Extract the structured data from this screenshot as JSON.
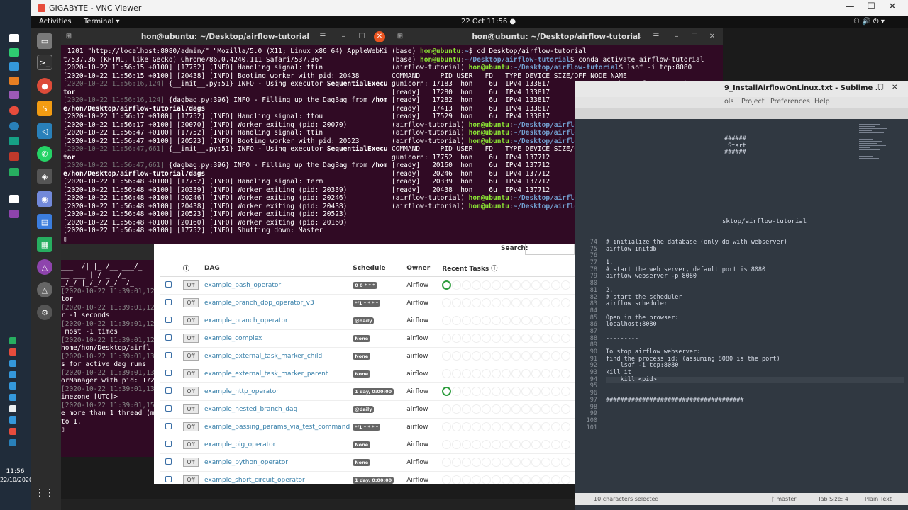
{
  "vnc": {
    "title": "GIGABYTE - VNC Viewer",
    "btn_min": "—",
    "btn_max": "☐",
    "btn_close": "✕"
  },
  "windows_taskbar": {
    "time": "11:56",
    "date": "22/10/2020"
  },
  "gnome": {
    "activities": "Activities",
    "app_menu": "Terminal ▾",
    "clock": "22 Oct  11:56  ●",
    "tray": "⚇ 🔊 ⏻ ▾"
  },
  "term_left": {
    "title": "hon@ubuntu: ~/Desktop/airflow-tutorial",
    "lines": [
      {
        "segs": [
          {
            "t": " 1201 \"http://localhost:8080/admin/\" \"Mozilla/5.0 (X11; Linux x86_64) AppleWebKi"
          }
        ]
      },
      {
        "segs": [
          {
            "t": "t/537.36 (KHTML, like Gecko) Chrome/86.0.4240.111 Safari/537.36\""
          }
        ]
      },
      {
        "segs": [
          {
            "t": "[2020-10-22 11:56:15 +0100] [17752] [INFO] Handling signal: ttin"
          }
        ]
      },
      {
        "segs": [
          {
            "t": "[2020-10-22 11:56:15 +0100] [20438] [INFO] Booting worker with pid: 20438"
          }
        ]
      },
      {
        "segs": [
          {
            "t": "[2020-10-22 11:56:16,124]",
            "c": "dim"
          },
          {
            "t": " {__init__.py:51} INFO - Using executor "
          },
          {
            "t": "SequentialExecu",
            "c": "bo"
          }
        ]
      },
      {
        "segs": [
          {
            "t": "tor",
            "c": "bo"
          }
        ]
      },
      {
        "segs": [
          {
            "t": "[2020-10-22 11:56:16,124]",
            "c": "dim"
          },
          {
            "t": " {dagbag.py:396} INFO - Filling up the DagBag from "
          },
          {
            "t": "/hom",
            "c": "bo"
          }
        ]
      },
      {
        "segs": [
          {
            "t": "e/hon/Desktop/airflow-tutorial/dags",
            "c": "bo"
          }
        ]
      },
      {
        "segs": [
          {
            "t": "[2020-10-22 11:56:17 +0100] [17752] [INFO] Handling signal: ttou"
          }
        ]
      },
      {
        "segs": [
          {
            "t": "[2020-10-22 11:56:17 +0100] [20070] [INFO] Worker exiting (pid: 20070)"
          }
        ]
      },
      {
        "segs": [
          {
            "t": "[2020-10-22 11:56:47 +0100] [17752] [INFO] Handling signal: ttin"
          }
        ]
      },
      {
        "segs": [
          {
            "t": "[2020-10-22 11:56:47 +0100] [20523] [INFO] Booting worker with pid: 20523"
          }
        ]
      },
      {
        "segs": [
          {
            "t": "[2020-10-22 11:56:47,661]",
            "c": "dim"
          },
          {
            "t": " {__init__.py:51} INFO - Using executor "
          },
          {
            "t": "SequentialExecu",
            "c": "bo"
          }
        ]
      },
      {
        "segs": [
          {
            "t": "tor",
            "c": "bo"
          }
        ]
      },
      {
        "segs": [
          {
            "t": "[2020-10-22 11:56:47,661]",
            "c": "dim"
          },
          {
            "t": " {dagbag.py:396} INFO - Filling up the DagBag from "
          },
          {
            "t": "/hom",
            "c": "bo"
          }
        ]
      },
      {
        "segs": [
          {
            "t": "e/hon/Desktop/airflow-tutorial/dags",
            "c": "bo"
          }
        ]
      },
      {
        "segs": [
          {
            "t": "[2020-10-22 11:56:48 +0100] [17752] [INFO] Handling signal: term"
          }
        ]
      },
      {
        "segs": [
          {
            "t": "[2020-10-22 11:56:48 +0100] [20339] [INFO] Worker exiting (pid: 20339)"
          }
        ]
      },
      {
        "segs": [
          {
            "t": "[2020-10-22 11:56:48 +0100] [20246] [INFO] Worker exiting (pid: 20246)"
          }
        ]
      },
      {
        "segs": [
          {
            "t": "[2020-10-22 11:56:48 +0100] [20438] [INFO] Worker exiting (pid: 20438)"
          }
        ]
      },
      {
        "segs": [
          {
            "t": "[2020-10-22 11:56:48 +0100] [20523] [INFO] Worker exiting (pid: 20523)"
          }
        ]
      },
      {
        "segs": [
          {
            "t": "[2020-10-22 11:56:48 +0100] [20160] [INFO] Worker exiting (pid: 20160)"
          }
        ]
      },
      {
        "segs": [
          {
            "t": "[2020-10-22 11:56:48 +0100] [17752] [INFO] Shutting down: Master"
          }
        ]
      },
      {
        "segs": [
          {
            "t": "▯"
          }
        ]
      }
    ]
  },
  "term_right": {
    "title": "hon@ubuntu: ~/Desktop/airflow-tutorial",
    "lines": [
      {
        "segs": [
          {
            "t": "(base) "
          },
          {
            "t": "hon@ubuntu",
            "c": "pg"
          },
          {
            "t": ":"
          },
          {
            "t": "~",
            "c": "pb"
          },
          {
            "t": "$ cd Desktop/airflow-tutorial"
          }
        ]
      },
      {
        "segs": [
          {
            "t": "(base) "
          },
          {
            "t": "hon@ubuntu",
            "c": "pg"
          },
          {
            "t": ":"
          },
          {
            "t": "~/Desktop/airflow-tutorial",
            "c": "pb"
          },
          {
            "t": "$ conda activate airflow-tutorial"
          }
        ]
      },
      {
        "segs": [
          {
            "t": "(airflow-tutorial) "
          },
          {
            "t": "hon@ubuntu",
            "c": "pg"
          },
          {
            "t": ":"
          },
          {
            "t": "~/Desktop/airflow-tutorial",
            "c": "pb"
          },
          {
            "t": "$ lsof -i tcp:8080"
          }
        ]
      },
      {
        "segs": [
          {
            "t": "COMMAND     PID USER   FD   TYPE DEVICE SIZE/OFF NODE NAME"
          }
        ]
      },
      {
        "segs": [
          {
            "t": "gunicorn: 17183  hon    6u  IPv4 133817      0t0  TCP *:http-alt (LISTEN)"
          }
        ]
      },
      {
        "segs": [
          {
            "t": "[ready]   17280  hon    6u  IPv4 133817      0t0  TCP *:http-alt (LISTEN)"
          }
        ]
      },
      {
        "segs": [
          {
            "t": "[ready]   17282  hon    6u  IPv4 133817      0t0  TCP *:http-alt (LISTEN)"
          }
        ]
      },
      {
        "segs": [
          {
            "t": "[ready]   17413  hon    6u  IPv4 133817      0t0  TCP *:http-alt (LISTEN)"
          }
        ]
      },
      {
        "segs": [
          {
            "t": "[ready]   17529  hon    6u  IPv4 133817      0t0  TCP *:http-alt (LISTEN)"
          }
        ]
      },
      {
        "segs": [
          {
            "t": "(airflow-tutorial) "
          },
          {
            "t": "hon@ubuntu",
            "c": "pg"
          },
          {
            "t": ":"
          },
          {
            "t": "~/Desktop/airflow-tutorial",
            "c": "pb"
          },
          {
            "t": "$ kill 17183"
          }
        ]
      },
      {
        "segs": [
          {
            "t": "(airflow-tutorial) "
          },
          {
            "t": "hon@ubuntu",
            "c": "pg"
          },
          {
            "t": ":"
          },
          {
            "t": "~/Desktop/airflow-tutorial",
            "c": "pb"
          },
          {
            "t": "$ lsof -i tcp:8080"
          }
        ]
      },
      {
        "segs": [
          {
            "t": "(airflow-tutorial) "
          },
          {
            "t": "hon@ubuntu",
            "c": "pg"
          },
          {
            "t": ":"
          },
          {
            "t": "~/Desktop/airflow-tutorial",
            "c": "pb"
          },
          {
            "t": "$ lsof -i tcp:8080"
          }
        ]
      },
      {
        "segs": [
          {
            "t": "COMMAND     PID USER   FD   TYPE DEVICE SIZE/OFF NODE NAME"
          }
        ]
      },
      {
        "segs": [
          {
            "t": "gunicorn: 17752  hon    6u  IPv4 137712      0t0  TCP *:http-alt (LISTEN)"
          }
        ]
      },
      {
        "segs": [
          {
            "t": "[ready]   20160  hon    6u  IPv4 137712      0t0  TCP *:http-alt (LISTEN)"
          }
        ]
      },
      {
        "segs": [
          {
            "t": "[ready]   20246  hon    6u  IPv4 137712      0t0  TCP *:http-alt (LISTEN)"
          }
        ]
      },
      {
        "segs": [
          {
            "t": "[ready]   20339  hon    6u  IPv4 137712      0t0  TCP *:http-alt (LISTEN)"
          }
        ]
      },
      {
        "segs": [
          {
            "t": "[ready]   20438  hon    6u  IPv4 137712      0t0  TCP *:http-alt (LISTEN)"
          }
        ]
      },
      {
        "segs": [
          {
            "t": "(airflow-tutorial) "
          },
          {
            "t": "hon@ubuntu",
            "c": "pg"
          },
          {
            "t": ":"
          },
          {
            "t": "~/Desktop/airflow-tutorial",
            "c": "pb"
          },
          {
            "t": "$ kill 17752"
          }
        ]
      },
      {
        "segs": [
          {
            "t": "(airflow-tutorial) "
          },
          {
            "t": "hon@ubuntu",
            "c": "pg"
          },
          {
            "t": ":"
          },
          {
            "t": "~/Desktop/airflow-tutorial",
            "c": "pb"
          },
          {
            "t": "$ ▯"
          }
        ]
      }
    ]
  },
  "bg_term": {
    "lines": [
      {
        "t": "___  /| |_ /__ ___/_"
      },
      {
        "t": "__ ___ | / _  /_"
      },
      {
        "t": "_/_/ |_/_/ /_/  /_"
      },
      {
        "t": "[2020-10-22 11:39:01,12",
        "g": true
      },
      {
        "t": "tor"
      },
      {
        "t": "[2020-10-22 11:39:01,12",
        "g": true
      },
      {
        "t": "r -1 seconds"
      },
      {
        "t": "[2020-10-22 11:39:01,12",
        "g": true
      },
      {
        "t": " most -1 times"
      },
      {
        "t": "[2020-10-22 11:39:01,12",
        "g": true
      },
      {
        "t": "home/hon/Desktop/airfl"
      },
      {
        "t": "[2020-10-22 11:39:01,13",
        "g": true
      },
      {
        "t": "s for active dag runs"
      },
      {
        "t": "[2020-10-22 11:39:01,13",
        "g": true
      },
      {
        "t": "orManager with pid: 172"
      },
      {
        "t": "[2020-10-22 11:39:01,13",
        "g": true
      },
      {
        "t": "imezone [UTC]>"
      },
      {
        "t": "[2020-10-22 11:39:01,15",
        "g": true
      },
      {
        "t": "e more than 1 thread (m"
      },
      {
        "t": "to 1."
      },
      {
        "t": "▯"
      }
    ]
  },
  "airflow": {
    "search_label": "Search:",
    "headers": {
      "info": "ⓘ",
      "dag": "DAG",
      "schedule": "Schedule",
      "owner": "Owner",
      "recent": "Recent Tasks ⓘ"
    },
    "toggle_label": "Off",
    "rows": [
      {
        "dag": "example_bash_operator",
        "schedule": "0 0 * * *",
        "owner": "Airflow",
        "ok": true
      },
      {
        "dag": "example_branch_dop_operator_v3",
        "schedule": "*/1 * * * *",
        "owner": "Airflow",
        "ok": false
      },
      {
        "dag": "example_branch_operator",
        "schedule": "@daily",
        "owner": "Airflow",
        "ok": false
      },
      {
        "dag": "example_complex",
        "schedule": "None",
        "owner": "airflow",
        "ok": false
      },
      {
        "dag": "example_external_task_marker_child",
        "schedule": "None",
        "owner": "airflow",
        "ok": false
      },
      {
        "dag": "example_external_task_marker_parent",
        "schedule": "None",
        "owner": "airflow",
        "ok": false
      },
      {
        "dag": "example_http_operator",
        "schedule": "1 day, 0:00:00",
        "owner": "Airflow",
        "ok": true
      },
      {
        "dag": "example_nested_branch_dag",
        "schedule": "@daily",
        "owner": "airflow",
        "ok": false
      },
      {
        "dag": "example_passing_params_via_test_command",
        "schedule": "*/1 * * * *",
        "owner": "airflow",
        "ok": false
      },
      {
        "dag": "example_pig_operator",
        "schedule": "None",
        "owner": "Airflow",
        "ok": false
      },
      {
        "dag": "example_python_operator",
        "schedule": "None",
        "owner": "Airflow",
        "ok": false
      },
      {
        "dag": "example_short_circuit_operator",
        "schedule": "1 day, 0:00:00",
        "owner": "Airflow",
        "ok": false
      }
    ]
  },
  "sublime": {
    "title": "9_InstallAirflowOnLinux.txt - Sublime ...",
    "menu": [
      "ols",
      "Project",
      "Preferences",
      "Help"
    ],
    "top_text": "######\n Start\n######",
    "path_text": "sktop/airflow-tutorial",
    "lines": [
      {
        "n": "74",
        "c": "# initialize the database (only do with webserver)"
      },
      {
        "n": "75",
        "c": "airflow initdb"
      },
      {
        "n": "76",
        "c": ""
      },
      {
        "n": "77",
        "c": "1."
      },
      {
        "n": "78",
        "c": "# start the web server, default port is 8080"
      },
      {
        "n": "79",
        "c": "airflow webserver -p 8080"
      },
      {
        "n": "80",
        "c": ""
      },
      {
        "n": "81",
        "c": "2."
      },
      {
        "n": "82",
        "c": "# start the scheduler"
      },
      {
        "n": "83",
        "c": "airflow scheduler"
      },
      {
        "n": "84",
        "c": ""
      },
      {
        "n": "85",
        "c": "Open in the browser:"
      },
      {
        "n": "86",
        "c": "localhost:8080"
      },
      {
        "n": "87",
        "c": ""
      },
      {
        "n": "88",
        "c": "---------"
      },
      {
        "n": "89",
        "c": ""
      },
      {
        "n": "90",
        "c": "To stop airflow webserver:"
      },
      {
        "n": "91",
        "c": "find the process id: (assuming 8080 is the port)"
      },
      {
        "n": "92",
        "c": "    lsof -i tcp:8080"
      },
      {
        "n": "93",
        "c": "kill it"
      },
      {
        "n": "94",
        "c": "    kill <pid>",
        "cur": true
      },
      {
        "n": "95",
        "c": ""
      },
      {
        "n": "96",
        "c": ""
      },
      {
        "n": "97",
        "c": "######################################"
      },
      {
        "n": "98",
        "c": ""
      },
      {
        "n": "99",
        "c": ""
      },
      {
        "n": "100",
        "c": ""
      },
      {
        "n": "101",
        "c": ""
      }
    ],
    "status": {
      "selection": "10 characters selected",
      "branch": "ᚠ master",
      "tab": "Tab Size: 4",
      "syntax": "Plain Text"
    }
  }
}
